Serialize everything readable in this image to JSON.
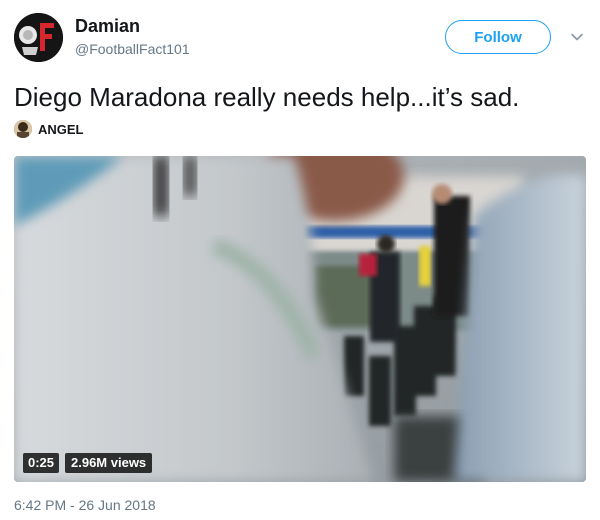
{
  "author": {
    "display_name": "Damian",
    "handle": "@FootballFact101"
  },
  "follow_label": "Follow",
  "tweet": {
    "text": "Diego Maradona really needs help...it’s sad."
  },
  "mention": {
    "name": "ANGEL"
  },
  "video": {
    "duration": "0:25",
    "views": "2.96M views"
  },
  "timestamp": "6:42 PM - 26 Jun 2018",
  "colors": {
    "accent": "#1da1f2",
    "secondary_text": "#657786",
    "primary_text": "#14171a"
  },
  "icons": {
    "caret": "chevron-down-icon"
  }
}
